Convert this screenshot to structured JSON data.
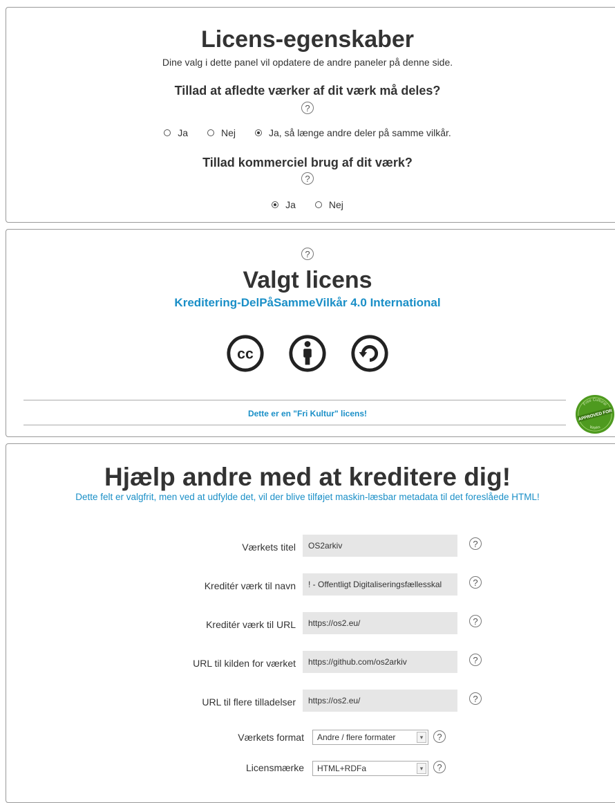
{
  "license_props": {
    "title": "Licens-egenskaber",
    "subtitle": "Dine valg i dette panel vil opdatere de andre paneler på denne side.",
    "q_derivatives": "Tillad at afledte værker af dit værk må deles?",
    "derivative_options": [
      "Ja",
      "Nej",
      "Ja, så længe andre deler på samme vilkår."
    ],
    "derivative_selected": 2,
    "q_commercial": "Tillad kommerciel brug af dit værk?",
    "commercial_options": [
      "Ja",
      "Nej"
    ],
    "commercial_selected": 0,
    "help_glyph": "?"
  },
  "selected_license": {
    "title": "Valgt licens",
    "license_name": "Kreditering-DelPåSammeVilkår 4.0 International",
    "icons": [
      "cc-icon",
      "attribution-icon",
      "share-alike-icon"
    ],
    "free_culture": "Dette er en \"Fri Kultur\" licens!",
    "badge_text": "APPROVED FOR",
    "badge_arc_top": "Free Cultural",
    "badge_arc_bottom": "Works"
  },
  "attribution": {
    "title": "Hjælp andre med at kreditere dig!",
    "subtitle": "Dette felt er valgfrit, men ved at udfylde det, vil der blive tilføjet maskin-læsbar metadata til det foreslåede HTML!",
    "fields": [
      {
        "label": "Værkets titel",
        "value": "OS2arkiv"
      },
      {
        "label": "Kreditér værk til navn",
        "value": "! - Offentligt Digitaliseringsfællesskal"
      },
      {
        "label": "Kreditér værk til URL",
        "value": "https://os2.eu/"
      },
      {
        "label": "URL til kilden for værket",
        "value": "https://github.com/os2arkiv"
      },
      {
        "label": "URL til flere tilladelser",
        "value": "https://os2.eu/"
      }
    ],
    "format_label": "Værkets format",
    "format_value": "Andre / flere formater",
    "mark_label": "Licensmærke",
    "mark_value": "HTML+RDFa"
  },
  "colors": {
    "accent": "#1a8fc7",
    "badge_green": "#4e9a1f"
  }
}
